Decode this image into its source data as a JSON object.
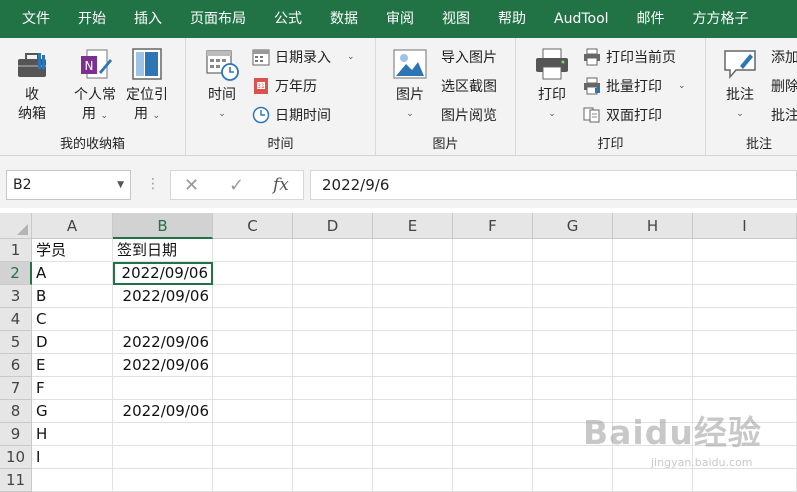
{
  "menu": [
    "文件",
    "开始",
    "插入",
    "页面布局",
    "公式",
    "数据",
    "审阅",
    "视图",
    "帮助",
    "AudTool",
    "邮件",
    "方方格子"
  ],
  "ribbon": {
    "group_storage": {
      "label": "我的收纳箱",
      "storage_btn": [
        "收",
        "纳箱"
      ],
      "personal_btn": [
        "个人常",
        "用"
      ],
      "locate_btn": [
        "定位引",
        "用"
      ]
    },
    "group_time": {
      "label": "时间",
      "time_btn": "时间",
      "date_entry": "日期录入",
      "calendar": "万年历",
      "datetime": "日期时间"
    },
    "group_image": {
      "label": "图片",
      "image_btn": "图片",
      "import_image": "导入图片",
      "screenshot": "选区截图",
      "image_view": "图片阅览"
    },
    "group_print": {
      "label": "打印",
      "print_btn": "打印",
      "print_current": "打印当前页",
      "batch_print": "批量打印",
      "duplex_print": "双面打印"
    },
    "group_comment": {
      "label": "批注",
      "comment_btn": "批注",
      "add": "添加",
      "delete": "删除",
      "comment2": "批注"
    }
  },
  "formula_bar": {
    "name_box": "B2",
    "fx_label": "fx",
    "cancel": "✕",
    "confirm": "✓",
    "formula": "2022/9/6"
  },
  "columns": [
    "A",
    "B",
    "C",
    "D",
    "E",
    "F",
    "G",
    "H",
    "I"
  ],
  "rows": [
    {
      "n": "1",
      "a": "学员",
      "b": "签到日期"
    },
    {
      "n": "2",
      "a": "A",
      "b": "2022/09/06"
    },
    {
      "n": "3",
      "a": "B",
      "b": "2022/09/06"
    },
    {
      "n": "4",
      "a": "C",
      "b": ""
    },
    {
      "n": "5",
      "a": "D",
      "b": "2022/09/06"
    },
    {
      "n": "6",
      "a": "E",
      "b": "2022/09/06"
    },
    {
      "n": "7",
      "a": "F",
      "b": ""
    },
    {
      "n": "8",
      "a": "G",
      "b": "2022/09/06"
    },
    {
      "n": "9",
      "a": "H",
      "b": ""
    },
    {
      "n": "10",
      "a": "I",
      "b": ""
    },
    {
      "n": "11",
      "a": "",
      "b": ""
    }
  ],
  "watermark": {
    "main": "Baidu经验",
    "sub": "jingyan.baidu.com"
  },
  "colors": {
    "accent": "#217346"
  }
}
